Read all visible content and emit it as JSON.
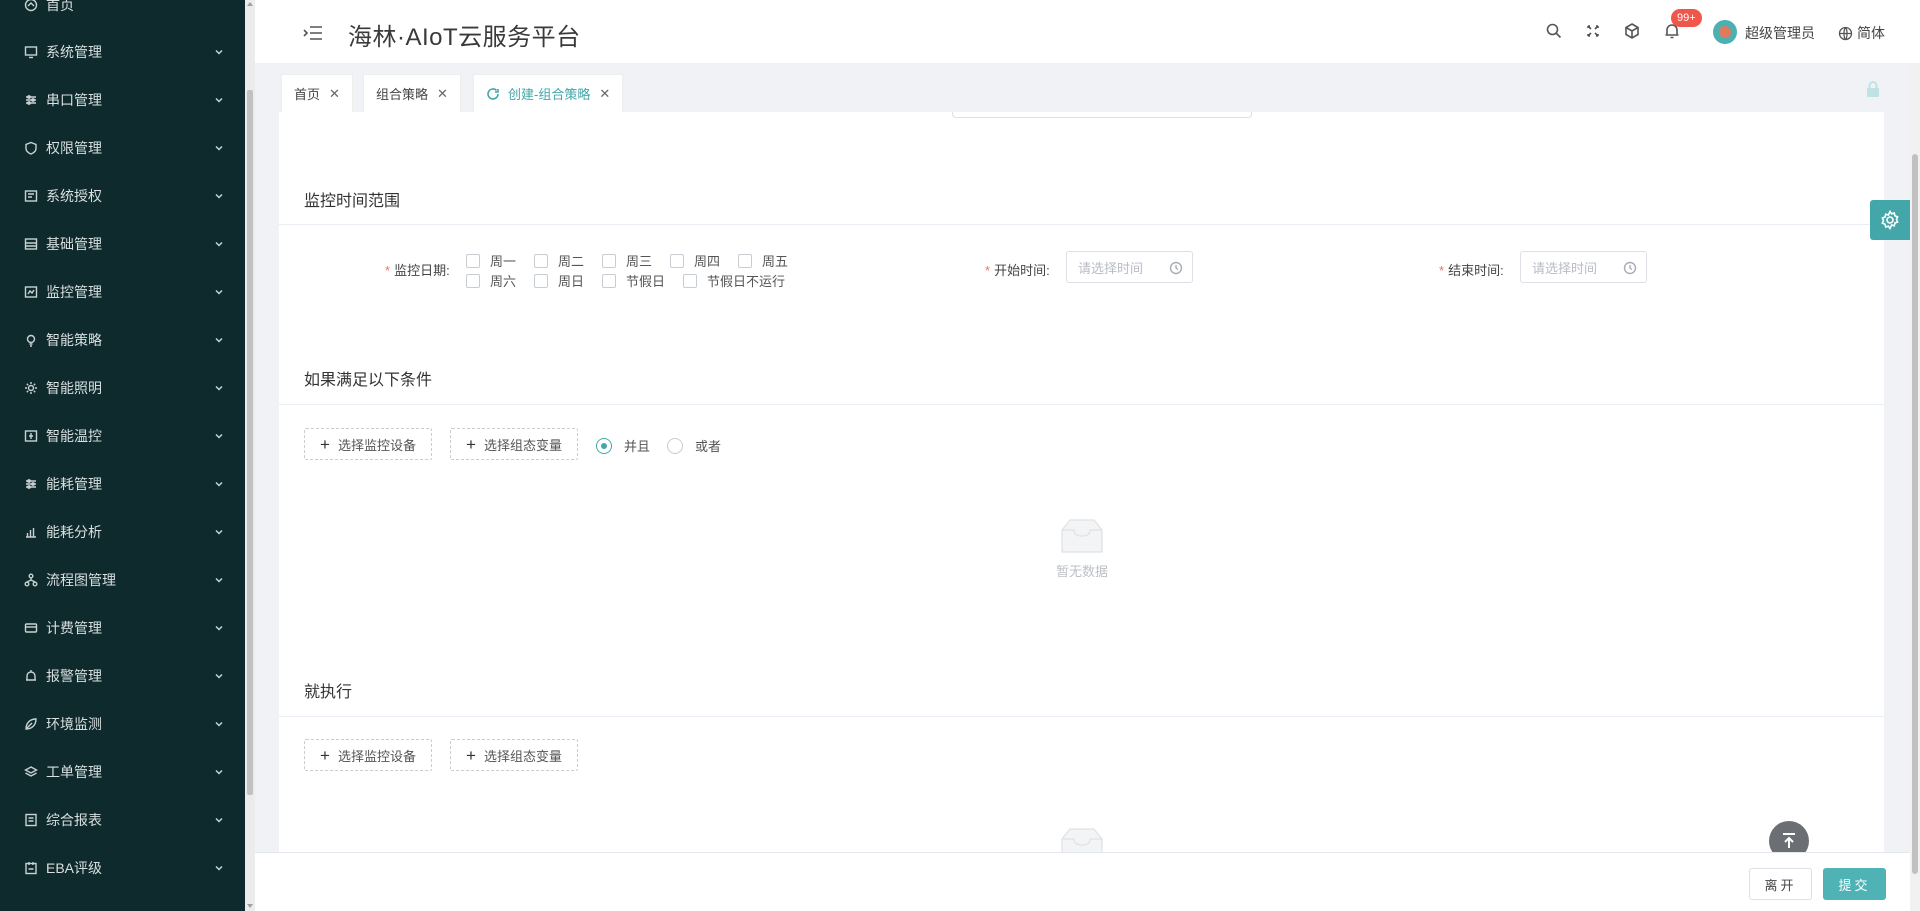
{
  "header": {
    "title": "海林·AIoT云服务平台",
    "badge": "99+",
    "user_name": "超级管理员",
    "language": "简体"
  },
  "sidebar": {
    "items": [
      {
        "label": "首页",
        "icon": "home-icon"
      },
      {
        "label": "系统管理",
        "icon": "monitor-icon"
      },
      {
        "label": "串口管理",
        "icon": "sliders-icon"
      },
      {
        "label": "权限管理",
        "icon": "shield-icon"
      },
      {
        "label": "系统授权",
        "icon": "license-icon"
      },
      {
        "label": "基础管理",
        "icon": "database-icon"
      },
      {
        "label": "监控管理",
        "icon": "monitor-control-icon"
      },
      {
        "label": "智能策略",
        "icon": "bulb-icon"
      },
      {
        "label": "智能照明",
        "icon": "sun-icon"
      },
      {
        "label": "智能温控",
        "icon": "thermostat-icon"
      },
      {
        "label": "能耗管理",
        "icon": "sliders-icon"
      },
      {
        "label": "能耗分析",
        "icon": "chart-icon"
      },
      {
        "label": "流程图管理",
        "icon": "flow-icon"
      },
      {
        "label": "计费管理",
        "icon": "billing-icon"
      },
      {
        "label": "报警管理",
        "icon": "alarm-icon"
      },
      {
        "label": "环境监测",
        "icon": "leaf-icon"
      },
      {
        "label": "工单管理",
        "icon": "layers-icon"
      },
      {
        "label": "综合报表",
        "icon": "report-icon"
      },
      {
        "label": "EBA评级",
        "icon": "rating-icon"
      }
    ]
  },
  "tabs": [
    {
      "label": "首页",
      "active": false
    },
    {
      "label": "组合策略",
      "active": false
    },
    {
      "label": "创建-组合策略",
      "active": true
    }
  ],
  "sections": {
    "time_range": "监控时间范围",
    "conditions": "如果满足以下条件",
    "execute": "就执行"
  },
  "form": {
    "monitor_date_label": "监控日期:",
    "weekdays_row1": [
      "周一",
      "周二",
      "周三",
      "周四",
      "周五"
    ],
    "weekdays_row2": [
      "周六",
      "周日",
      "节假日",
      "节假日不运行"
    ],
    "start_time_label": "开始时间:",
    "end_time_label": "结束时间:",
    "time_placeholder": "请选择时间"
  },
  "conditions": {
    "select_device": "选择监控设备",
    "select_variable": "选择组态变量",
    "logic_and": "并且",
    "logic_or": "或者",
    "logic_selected": "并且"
  },
  "empty_text": "暂无数据",
  "footer": {
    "leave": "离开",
    "submit": "提交"
  },
  "colors": {
    "accent": "#43a7a9",
    "sidebar_bg": "#0f2a2c",
    "badge": "#f0564a"
  }
}
